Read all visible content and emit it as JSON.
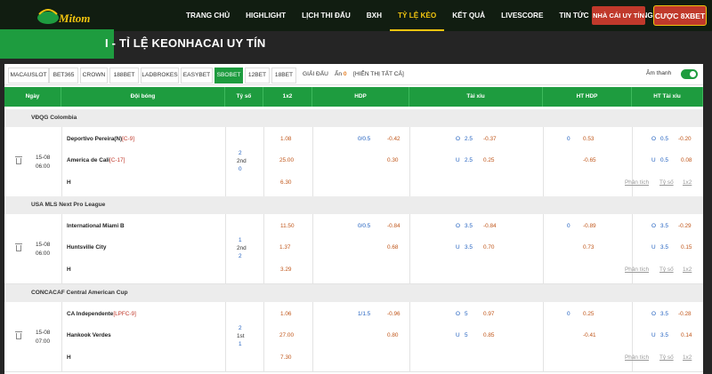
{
  "header": {
    "logo_text": "Mitom",
    "nav": [
      "TRANG CHỦ",
      "HIGHLIGHT",
      "LỊCH THI ĐẤU",
      "BXH",
      "TỶ LỆ KÈO",
      "KẾT QUẢ",
      "LIVESCORE",
      "TIN TỨC",
      "TUYỂN DỤNG"
    ],
    "active_nav": "TỶ LỆ KÈO",
    "btn_nhacai": "NHÀ CÁI UY TÍN",
    "btn_8xbet": "CƯỢC 8XBET",
    "colors": {
      "header_bg": "#111d11",
      "green": "#1e9c3f",
      "red": "#c0392b",
      "gold": "#f1c40f"
    }
  },
  "page_title": "I - TỈ LỆ KEONHACAI UY TÍN",
  "tabs": [
    "MACAUSLOT",
    "BET365",
    "CROWN",
    "188BET",
    "LADBROKES",
    "EASYBET",
    "SBOBET",
    "12BET",
    "18BET"
  ],
  "active_tab": "SBOBET",
  "filter": {
    "giai_dau": "GIẢI ĐẤU",
    "an_label": "Ẩn",
    "an_count": "0",
    "show_all": "[HIỂN THỊ TẤT CẢ]",
    "sound": "Âm thanh"
  },
  "columns": [
    "Ngày",
    "Đội bóng",
    "Tỷ số",
    "1x2",
    "HDP",
    "Tài xỉu",
    "HT HDP",
    "HT Tài xỉu"
  ],
  "links": {
    "phan_tich": "Phân tích",
    "ty_so": "Tỷ số",
    "x12": "1x2"
  },
  "matches": [
    {
      "league": "VĐQG Colombia",
      "date": "15-08",
      "time": "06:00",
      "home": "Deportivo Pereira(N)",
      "home_tag": "[C-9]",
      "away": "America de Cali",
      "away_tag": "[C-17]",
      "score_home": "2",
      "period": "2nd",
      "score_away": "0",
      "x1": "1.08",
      "x2": "25.00",
      "xd": "6.30",
      "hdp_line": "0/0.5",
      "hdp_h": "-0.42",
      "hdp_a": "0.30",
      "ou_o": "O",
      "ou_line": "2.5",
      "ou_o_val": "-0.37",
      "ou_u": "U",
      "ou_line2": "2.5",
      "ou_u_val": "0.25",
      "hthdp_line": "0",
      "hthdp_h": "0.53",
      "hthdp_a": "-0.65",
      "htou_o": "O",
      "htou_line": "0.5",
      "htou_o_val": "-0.20",
      "htou_u": "U",
      "htou_line2": "0.5",
      "htou_u_val": "0.08",
      "draw": "H"
    },
    {
      "league": "USA MLS Next Pro League",
      "date": "15-08",
      "time": "06:00",
      "home": "International Miami B",
      "home_tag": "",
      "away": "Huntsville City",
      "away_tag": "",
      "score_home": "1",
      "period": "2nd",
      "score_away": "2",
      "x1": "11.50",
      "x2": "1.37",
      "xd": "3.29",
      "hdp_line": "0/0.5",
      "hdp_h": "-0.84",
      "hdp_a": "0.68",
      "ou_o": "O",
      "ou_line": "3.5",
      "ou_o_val": "-0.84",
      "ou_u": "U",
      "ou_line2": "3.5",
      "ou_u_val": "0.70",
      "hthdp_line": "0",
      "hthdp_h": "-0.89",
      "hthdp_a": "0.73",
      "htou_o": "O",
      "htou_line": "3.5",
      "htou_o_val": "-0.29",
      "htou_u": "U",
      "htou_line2": "3.5",
      "htou_u_val": "0.15",
      "draw": "H"
    },
    {
      "league": "CONCACAF Central American Cup",
      "date": "15-08",
      "time": "07:00",
      "home": "CA Independente",
      "home_tag": "[LPFC-9]",
      "away": "Hankook Verdes",
      "away_tag": "",
      "score_home": "2",
      "period": "1st",
      "score_away": "1",
      "x1": "1.06",
      "x2": "27.00",
      "xd": "7.30",
      "hdp_line": "1/1.5",
      "hdp_h": "-0.96",
      "hdp_a": "0.80",
      "ou_o": "O",
      "ou_line": "5",
      "ou_o_val": "0.97",
      "ou_u": "U",
      "ou_line2": "5",
      "ou_u_val": "0.85",
      "hthdp_line": "0",
      "hthdp_h": "0.25",
      "hthdp_a": "-0.41",
      "htou_o": "O",
      "htou_line": "3.5",
      "htou_o_val": "-0.28",
      "htou_u": "U",
      "htou_line2": "3.5",
      "htou_u_val": "0.14",
      "draw": "H"
    }
  ]
}
